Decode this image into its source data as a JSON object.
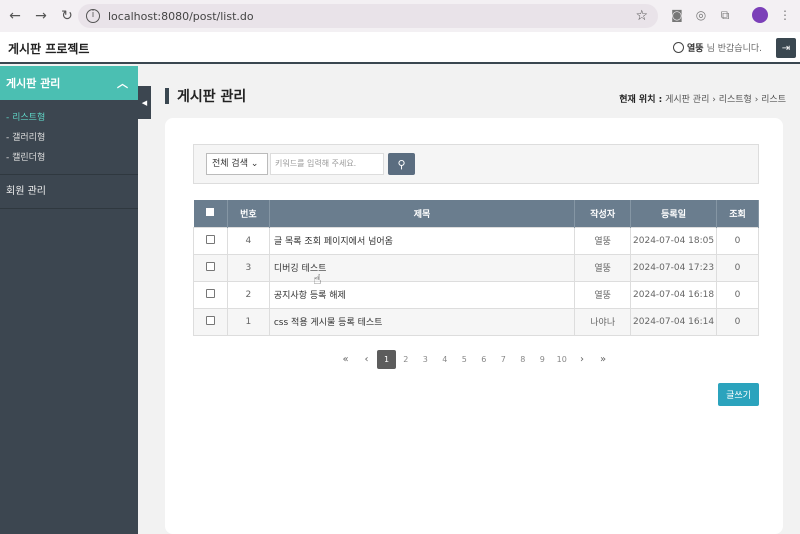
{
  "browser": {
    "url": "localhost:8080/post/list.do"
  },
  "app": {
    "brand": "게시판 프로젝트",
    "user_name": "열뚱",
    "greeting": "님 반갑습니다."
  },
  "sidebar": {
    "section": "게시판 관리",
    "items": [
      {
        "label": "리스트형",
        "active": true
      },
      {
        "label": "갤러리형"
      },
      {
        "label": "캘린더형"
      }
    ],
    "member": "회원 관리"
  },
  "page": {
    "title": "게시판 관리",
    "breadcrumb_label": "현재 위치 :",
    "breadcrumb": [
      "게시판 관리",
      "리스트형",
      "리스트"
    ]
  },
  "search": {
    "select": "전체 검색",
    "placeholder": "키워드를 입력해 주세요."
  },
  "table": {
    "headers": [
      "",
      "번호",
      "제목",
      "작성자",
      "등록일",
      "조회"
    ],
    "rows": [
      {
        "no": "4",
        "title": "글 목록 조회 페이지에서 넘어옴",
        "author": "열뚱",
        "date": "2024-07-04 18:05",
        "views": "0"
      },
      {
        "no": "3",
        "title": "디버깅 테스트",
        "author": "열뚱",
        "date": "2024-07-04 17:23",
        "views": "0"
      },
      {
        "no": "2",
        "title": "공지사항 등록 해제",
        "author": "열뚱",
        "date": "2024-07-04 16:18",
        "views": "0"
      },
      {
        "no": "1",
        "title": "css 적용 게시물 등록 테스트",
        "author": "나야나",
        "date": "2024-07-04 16:14",
        "views": "0"
      }
    ]
  },
  "pagination": {
    "pages": [
      "1",
      "2",
      "3",
      "4",
      "5",
      "6",
      "7",
      "8",
      "9",
      "10"
    ],
    "current": "1"
  },
  "write_button": "글쓰기",
  "colors": {
    "accent": "#4bbfb2",
    "sidebar": "#3c4650",
    "header": "#6a7d8e",
    "write": "#2ba3bd"
  }
}
